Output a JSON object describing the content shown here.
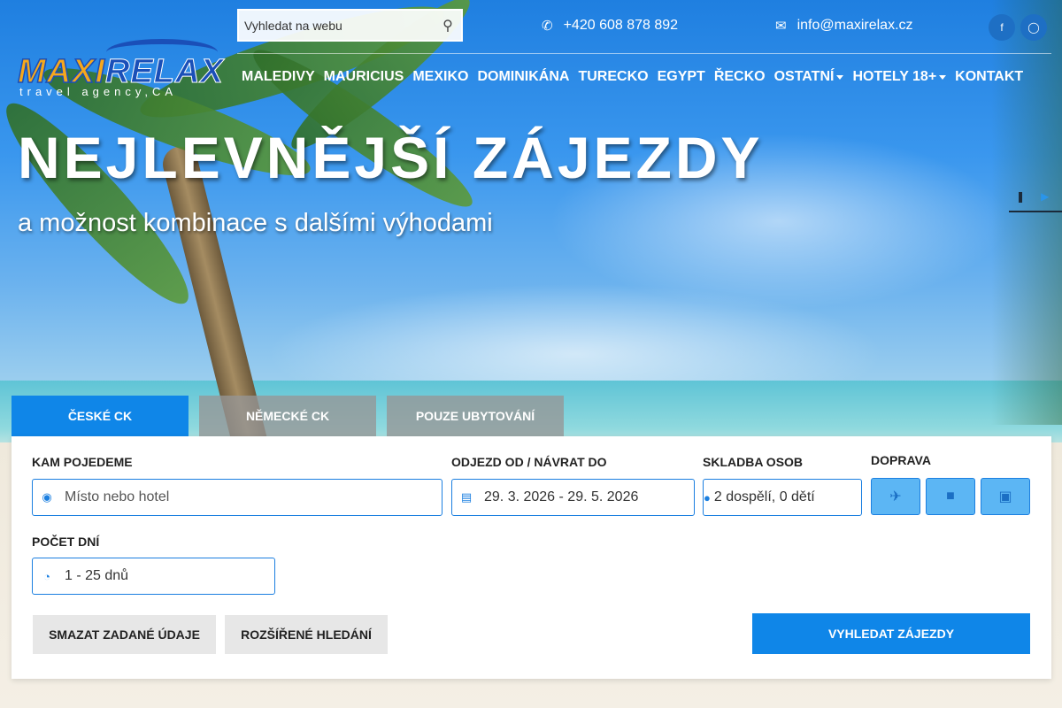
{
  "header": {
    "logo_text_maxi": "MAXI",
    "logo_text_relax": "RELAX",
    "logo_sub": "travel agency,CA",
    "search_placeholder": "Vyhledat na webu",
    "search_icon": "search-icon",
    "phone": "+420 608 878 892",
    "phone_icon": "phone-icon",
    "email": "info@maxirelax.cz",
    "email_icon": "envelope-icon",
    "social": [
      "facebook-icon",
      "instagram-icon"
    ]
  },
  "nav": {
    "items": [
      {
        "label": "MALEDIVY"
      },
      {
        "label": "MAURICIUS"
      },
      {
        "label": "MEXIKO"
      },
      {
        "label": "DOMINIKÁNA"
      },
      {
        "label": "TURECKO"
      },
      {
        "label": "EGYPT"
      },
      {
        "label": "ŘECKO"
      },
      {
        "label": "OSTATNÍ",
        "dropdown": true
      },
      {
        "label": "HOTELY 18+",
        "dropdown": true
      },
      {
        "label": "KONTAKT"
      }
    ]
  },
  "hero": {
    "title": "NEJLEVNĚJŠÍ ZÁJEZDY",
    "subtitle": "a možnost kombinace s dalšími výhodami"
  },
  "tabs": [
    {
      "label": "ČESKÉ CK",
      "active": true
    },
    {
      "label": "NĚMECKÉ CK",
      "active": false
    },
    {
      "label": "POUZE UBYTOVÁNÍ",
      "active": false
    }
  ],
  "form": {
    "destination_label": "KAM POJEDEME",
    "destination_placeholder": "Místo nebo hotel",
    "dates_label": "ODJEZD OD / NÁVRAT DO",
    "dates_value": "29. 3. 2026 - 29. 5. 2026",
    "persons_label": "SKLADBA OSOB",
    "persons_value": "2 dospělí, 0 dětí",
    "transport_label": "DOPRAVA",
    "transport_options": [
      "plane-icon",
      "car-icon",
      "bus-icon"
    ],
    "days_label": "POČET DNÍ",
    "days_value": "1 - 25 dnů",
    "clear_button": "SMAZAT ZADANÉ ÚDAJE",
    "advanced_button": "ROZŠÍŘENÉ HLEDÁNÍ",
    "search_button": "VYHLEDAT ZÁJEZDY"
  },
  "colors": {
    "accent": "#0f86e8",
    "tab_inactive": "#969696",
    "transport_btn": "#5cb6f4",
    "grey_btn": "#e7e7e7"
  }
}
